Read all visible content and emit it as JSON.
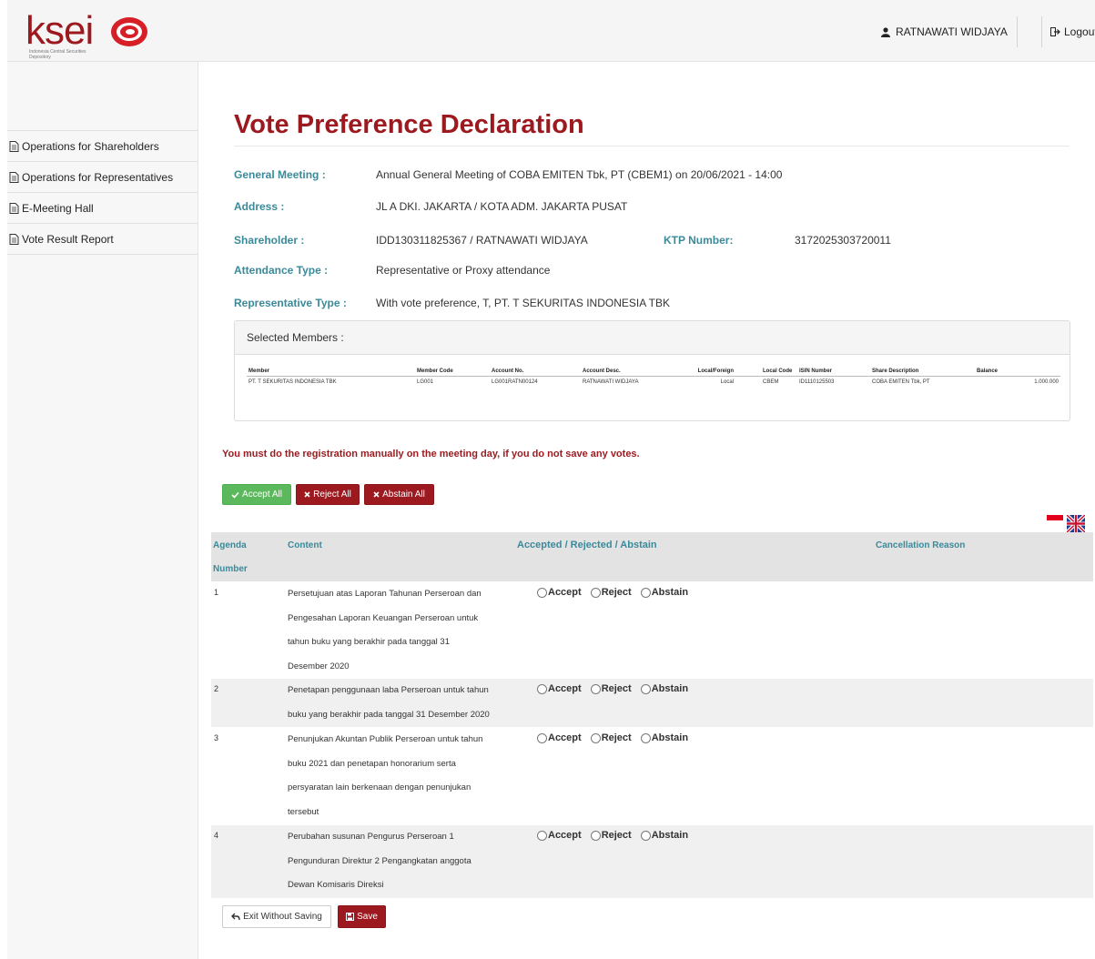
{
  "header": {
    "logo_text": "ksei",
    "logo_subtitle": "Indonesia Central Securities Depository",
    "user_name": "RATNAWATI WIDJAYA",
    "logout_label": "Logout"
  },
  "sidebar": {
    "items": [
      {
        "label": "Operations for Shareholders"
      },
      {
        "label": "Operations for Representatives"
      },
      {
        "label": "E-Meeting Hall"
      },
      {
        "label": "Vote Result Report"
      }
    ]
  },
  "page": {
    "title": "Vote Preference Declaration",
    "general_meeting_label": "General Meeting :",
    "general_meeting_value": "Annual General Meeting of COBA EMITEN Tbk, PT (CBEM1) on 20/06/2021 - 14:00",
    "address_label": "Address :",
    "address_value": "JL A DKI. JAKARTA / KOTA ADM. JAKARTA PUSAT",
    "shareholder_label": "Shareholder :",
    "shareholder_value": "IDD130311825367 / RATNAWATI WIDJAYA",
    "ktp_label": "KTP Number:",
    "ktp_value": "3172025303720011",
    "attendance_label": "Attendance Type :",
    "attendance_value": "Representative or Proxy attendance",
    "rep_type_label": "Representative Type :",
    "rep_type_value": "With vote preference, T, PT. T SEKURITAS INDONESIA TBK"
  },
  "members": {
    "heading": "Selected Members :",
    "columns": [
      "Member",
      "Member Code",
      "Account No.",
      "Account Desc.",
      "Local/Foreign",
      "Local Code",
      "ISIN Number",
      "Share Description",
      "Balance"
    ],
    "rows": [
      [
        "PT. T SEKURITAS INDONESIA TBK",
        "LG001",
        "LG001RATN00124",
        "RATNAWATI WIDJAYA",
        "Local",
        "CBEM",
        "ID1110125503",
        "COBA EMITEN Tbk, PT",
        "1.000.000"
      ]
    ]
  },
  "warning": "You must do the registration manually on the meeting day, if you do not save any votes.",
  "actions": {
    "accept_all": "Accept All",
    "reject_all": "Reject All",
    "abstain_all": "Abstain All",
    "exit": "Exit Without Saving",
    "save": "Save"
  },
  "agenda": {
    "col_number_1": "Agenda",
    "col_number_2": "Number",
    "col_content": "Content",
    "col_vote": "Accepted / Rejected / Abstain",
    "col_reason": "Cancellation Reason",
    "option_accept": "Accept",
    "option_reject": "Reject",
    "option_abstain": "Abstain",
    "rows": [
      {
        "number": "1",
        "lines": [
          "Persetujuan atas Laporan Tahunan Perseroan dan",
          "Pengesahan Laporan Keuangan Perseroan untuk",
          "tahun buku yang berakhir pada tanggal 31",
          "Desember 2020"
        ]
      },
      {
        "number": "2",
        "lines": [
          "Penetapan penggunaan laba Perseroan untuk tahun",
          "buku yang berakhir pada tanggal 31 Desember 2020"
        ]
      },
      {
        "number": "3",
        "lines": [
          "Penunjukan Akuntan Publik Perseroan untuk tahun",
          "buku 2021 dan penetapan honorarium serta",
          "persyaratan lain berkenaan dengan penunjukan",
          "tersebut"
        ]
      },
      {
        "number": "4",
        "lines": [
          "Perubahan susunan Pengurus Perseroan 1",
          "Pengunduran Direktur 2 Pengangkatan anggota",
          "Dewan Komisaris Direksi"
        ]
      }
    ]
  },
  "colors": {
    "brand_red": "#9c1a1f",
    "label_teal": "#3a8a9a",
    "accept_green": "#5cb85c"
  }
}
